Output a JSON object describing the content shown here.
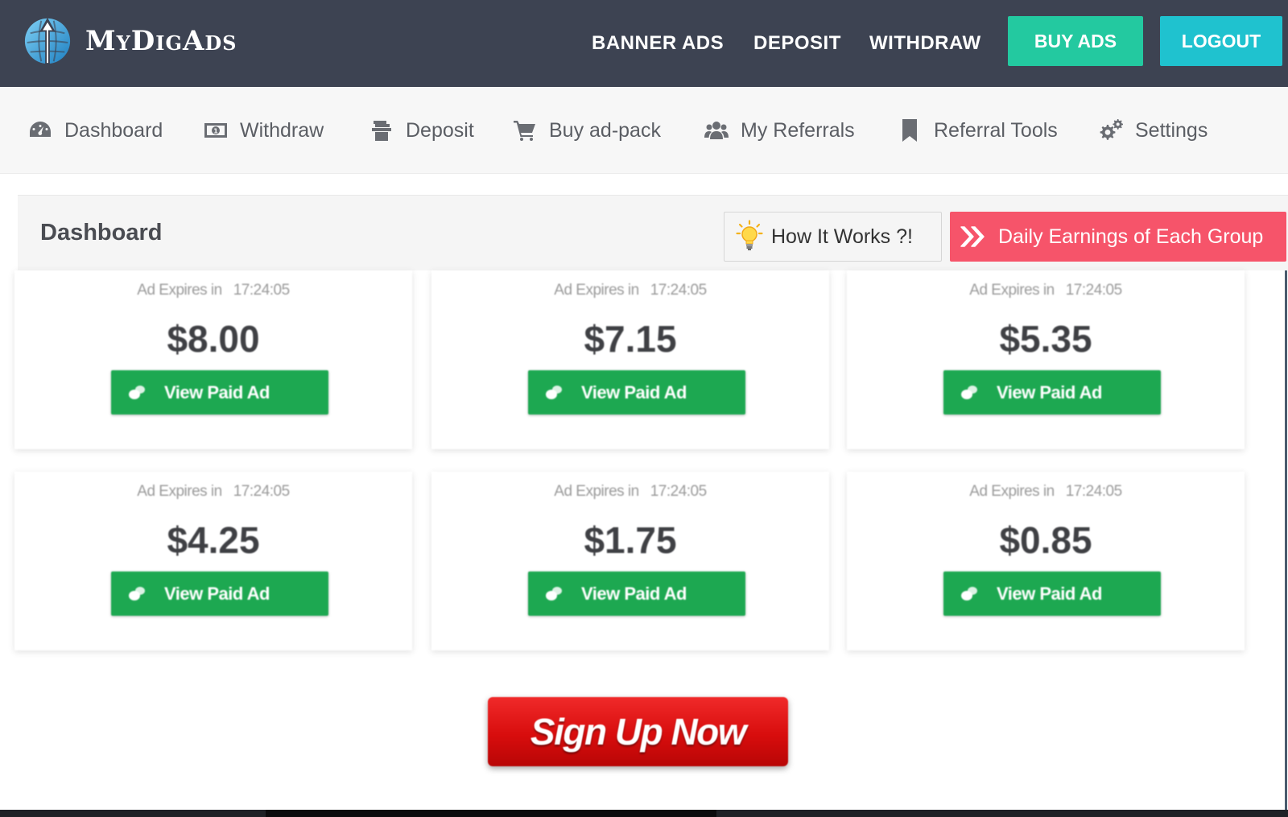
{
  "header": {
    "logo_text": "MyDigAds",
    "nav": [
      "BANNER ADS",
      "DEPOSIT",
      "WITHDRAW"
    ],
    "buy_ads_label": "BUY ADS",
    "logout_label": "LOGOUT",
    "colors": {
      "bg": "#3d4352",
      "buy": "#23c9a0",
      "logout": "#1fc2cf"
    }
  },
  "subnav": {
    "items": [
      {
        "label": "Dashboard",
        "icon": "dashboard-gauge-icon"
      },
      {
        "label": "Withdraw",
        "icon": "money-bill-icon"
      },
      {
        "label": "Deposit",
        "icon": "deposit-icon"
      },
      {
        "label": "Buy ad-pack",
        "icon": "cart-icon"
      },
      {
        "label": "My Referrals",
        "icon": "users-icon"
      },
      {
        "label": "Referral Tools",
        "icon": "bookmark-icon"
      },
      {
        "label": "Settings",
        "icon": "gears-icon"
      }
    ]
  },
  "dashboard": {
    "title": "Dashboard",
    "how_it_works_label": "How It Works ?!",
    "daily_earnings_label": "Daily Earnings of Each Group",
    "daily_color": "#f6546a"
  },
  "cards": [
    {
      "expires_label": "Ad Expires in",
      "expires_time": "17:24:05",
      "price": "$8.00",
      "button_label": "View Paid Ad"
    },
    {
      "expires_label": "Ad Expires in",
      "expires_time": "17:24:05",
      "price": "$7.15",
      "button_label": "View Paid Ad"
    },
    {
      "expires_label": "Ad Expires in",
      "expires_time": "17:24:05",
      "price": "$5.35",
      "button_label": "View Paid Ad"
    },
    {
      "expires_label": "Ad Expires in",
      "expires_time": "17:24:05",
      "price": "$4.25",
      "button_label": "View Paid Ad"
    },
    {
      "expires_label": "Ad Expires in",
      "expires_time": "17:24:05",
      "price": "$1.75",
      "button_label": "View Paid Ad"
    },
    {
      "expires_label": "Ad Expires in",
      "expires_time": "17:24:05",
      "price": "$0.85",
      "button_label": "View Paid Ad"
    }
  ],
  "signup": {
    "label": "Sign Up Now"
  }
}
